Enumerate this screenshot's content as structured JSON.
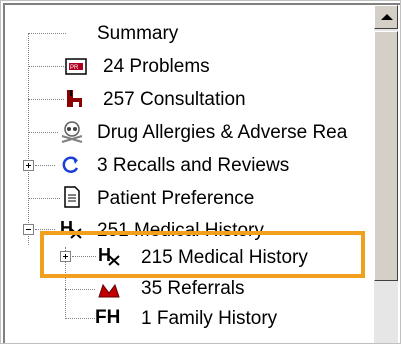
{
  "tree": {
    "items": [
      {
        "label": "Summary",
        "icon": "none",
        "expander": "none"
      },
      {
        "label": "24 Problems",
        "icon": "problems-icon",
        "expander": "none"
      },
      {
        "label": "257 Consultation",
        "icon": "consultation-icon",
        "expander": "none"
      },
      {
        "label": "Drug Allergies & Adverse Rea",
        "icon": "skull-icon",
        "expander": "none"
      },
      {
        "label": "3 Recalls and Reviews",
        "icon": "recall-icon",
        "expander": "plus"
      },
      {
        "label": "Patient Preference",
        "icon": "document-icon",
        "expander": "none"
      },
      {
        "label": "251 Medical History",
        "icon": "medical-history-icon",
        "expander": "minus"
      },
      {
        "label": "215 Medical History",
        "icon": "medical-history-icon",
        "expander": "plus"
      },
      {
        "label": "35 Referrals",
        "icon": "referral-icon",
        "expander": "none"
      },
      {
        "label": "1 Family History",
        "icon": "family-history-icon",
        "expander": "none"
      }
    ]
  },
  "highlight": {
    "color": "#f0a01c"
  },
  "icons": {
    "fh_text": "FH"
  }
}
